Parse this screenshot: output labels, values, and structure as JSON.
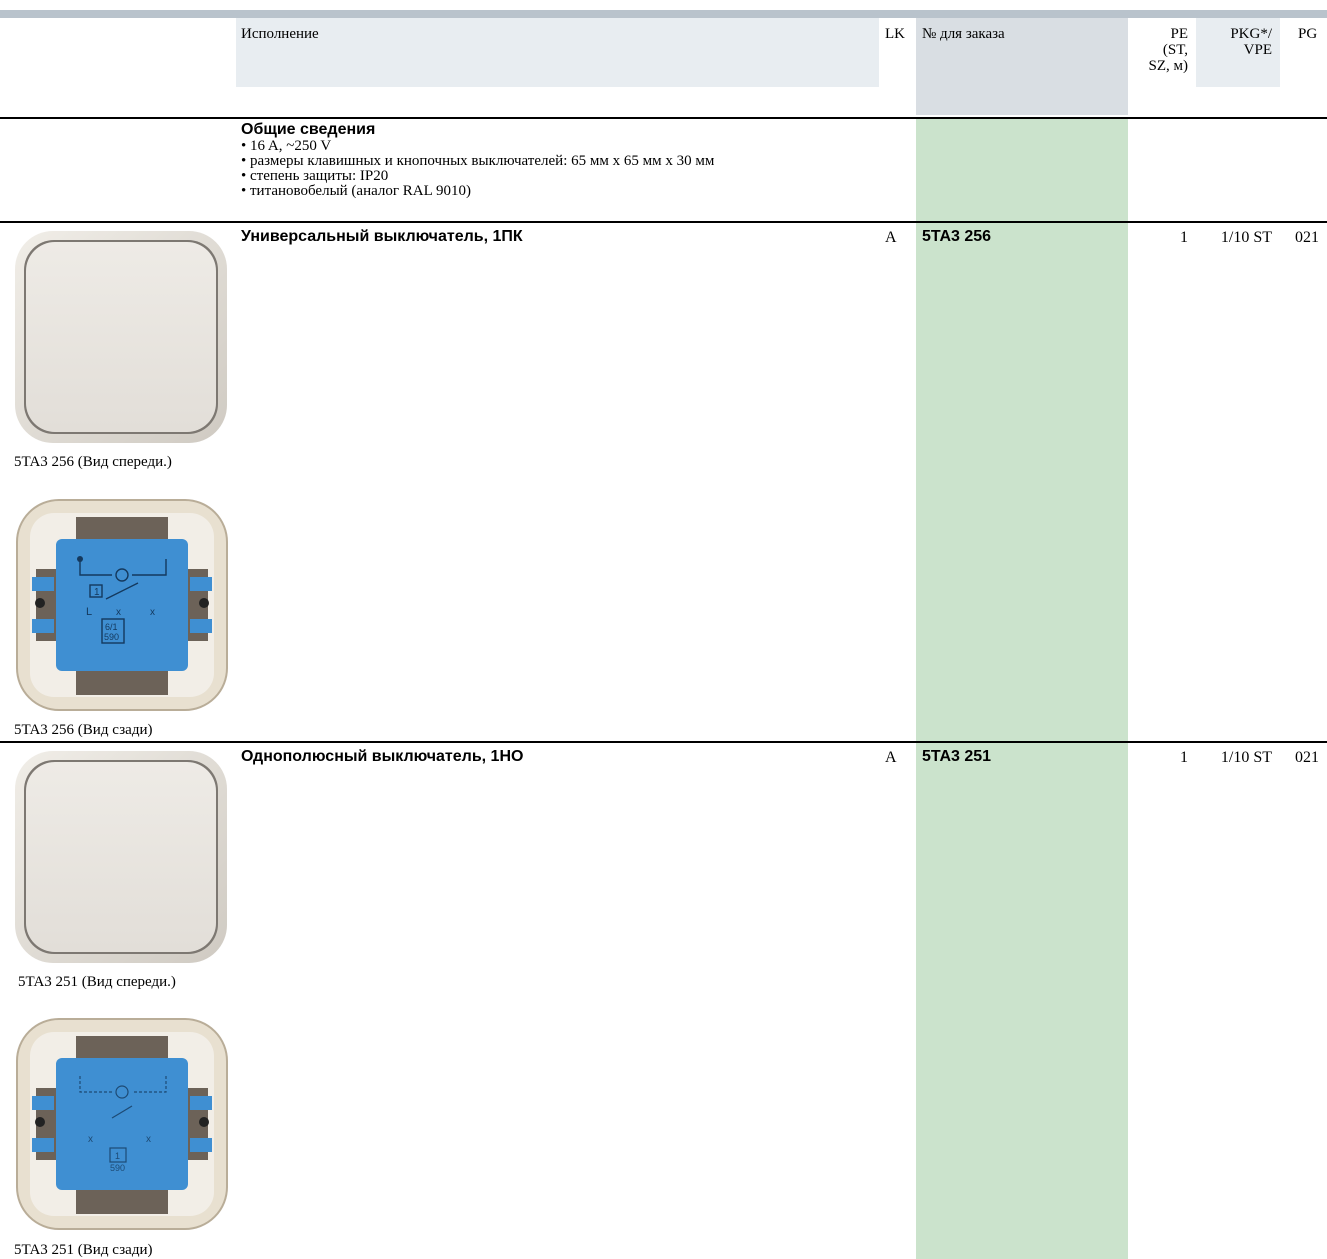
{
  "header": {
    "col_execution": "Исполнение",
    "col_lk": "LK",
    "col_order": "№ для заказа",
    "col_pe_line1": "PE",
    "col_pe_line2": "(ST,",
    "col_pe_line3": "SZ, м)",
    "col_pkg_line1": "PKG*/",
    "col_pkg_line2": "VPE",
    "col_pg": "PG"
  },
  "general": {
    "title": "Общие сведения",
    "bullets": [
      "• 16 A, ~250 V",
      "• размеры клавишных и кнопочных выключателей: 65 мм x 65 мм x 30 мм",
      "• степень защиты: IP20",
      "• титановобелый (аналог RAL 9010)"
    ]
  },
  "products": [
    {
      "title": "Универсальный выключатель, 1ПК",
      "lk": "A",
      "order_no": "5TA3 256",
      "pe": "1",
      "pkg": "1/10 ST",
      "pg": "021",
      "caption_front": "5TA3 256 (Вид спереди.)",
      "caption_back": "5TA3 256 (Вид сзади)",
      "back_label_1": "1",
      "back_label_2": "6/1",
      "back_label_3": "590",
      "back_label_L": "L",
      "back_label_x": "x"
    },
    {
      "title": "Однополюсный выключатель, 1НО",
      "lk": "A",
      "order_no": "5TA3 251",
      "pe": "1",
      "pkg": "1/10 ST",
      "pg": "021",
      "caption_front": "5TA3 251 (Вид спереди.)",
      "caption_back": "5TA3 251 (Вид сзади)",
      "back_label_1": "1",
      "back_label_3": "590",
      "back_label_x": "x"
    }
  ],
  "colors": {
    "header_band": "#e8edf1",
    "order_header": "#d9dee3",
    "order_column": "#cbe3cc",
    "top_bar": "#b9c3cc",
    "mechanism_blue": "#3f8fd2"
  }
}
